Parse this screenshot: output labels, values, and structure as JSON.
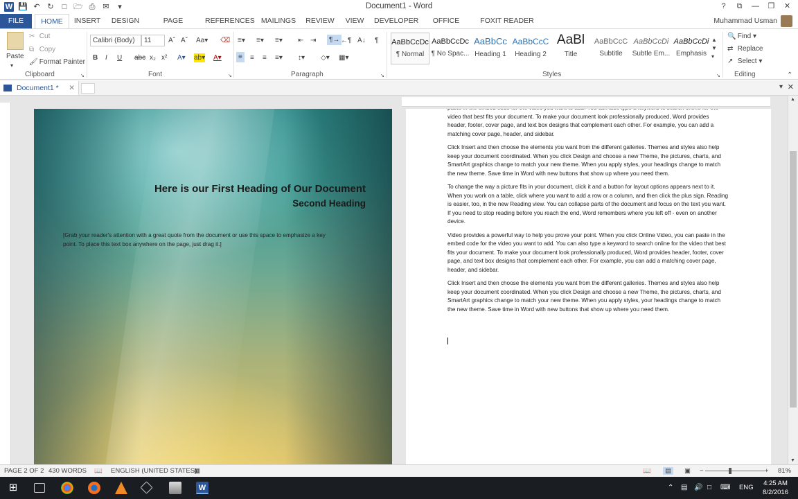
{
  "window": {
    "title": "Document1 - Word",
    "controls": [
      "?",
      "⧉",
      "—",
      "❐",
      "✕"
    ]
  },
  "tabs": {
    "file": "FILE",
    "items": [
      "HOME",
      "INSERT",
      "DESIGN",
      "PAGE LAYOUT",
      "REFERENCES",
      "MAILINGS",
      "REVIEW",
      "VIEW",
      "DEVELOPER",
      "OFFICE TAB",
      "FOXIT READER PDF"
    ],
    "active": "HOME"
  },
  "user": {
    "name": "Muhammad Usman"
  },
  "clipboard": {
    "paste": "Paste",
    "cut": "Cut",
    "copy": "Copy",
    "format_painter": "Format Painter",
    "label": "Clipboard"
  },
  "font": {
    "name": "Calibri (Body)",
    "size": "11",
    "label": "Font"
  },
  "paragraph": {
    "label": "Paragraph"
  },
  "styles": {
    "label": "Styles",
    "items": [
      {
        "sample": "AaBbCcDc",
        "name": "¶ Normal"
      },
      {
        "sample": "AaBbCcDc",
        "name": "¶ No Spac..."
      },
      {
        "sample": "AaBbCc",
        "name": "Heading 1"
      },
      {
        "sample": "AaBbCcC",
        "name": "Heading 2"
      },
      {
        "sample": "AaBl",
        "name": "Title"
      },
      {
        "sample": "AaBbCcC",
        "name": "Subtitle"
      },
      {
        "sample": "AaBbCcDi",
        "name": "Subtle Em..."
      },
      {
        "sample": "AaBbCcDi",
        "name": "Emphasis"
      }
    ]
  },
  "editing": {
    "find": "Find",
    "replace": "Replace",
    "select": "Select",
    "label": "Editing"
  },
  "doctab": {
    "name": "Document1 *",
    "close": "✕"
  },
  "cover": {
    "heading": "Here is our First Heading of Our Document",
    "subheading": "Second Heading",
    "quote": "[Grab your reader's attention with a great quote from the document or use this space to emphasize a key point. To place this text box anywhere on the page, just drag it.]"
  },
  "page2": {
    "paragraphs": [
      "paste in the embed code for the video you want to add. You can also type a keyword to search online for the video that best fits your document. To make your document look professionally produced, Word provides header, footer, cover page, and text box designs that complement each other. For example, you can add a matching cover page, header, and sidebar.",
      "Click Insert and then choose the elements you want from the different galleries. Themes and styles also help keep your document coordinated. When you click Design and choose a new Theme, the pictures, charts, and SmartArt graphics change to match your new theme. When you apply styles, your headings change to match the new theme. Save time in Word with new buttons that show up where you need them.",
      "To change the way a picture fits in your document, click it and a button for layout options appears next to it. When you work on a table, click where you want to add a row or a column, and then click the plus sign. Reading is easier, too, in the new Reading view. You can collapse parts of the document and focus on the text you want. If you need to stop reading before you reach the end, Word remembers where you left off - even on another device.",
      "Video provides a powerful way to help you prove your point. When you click Online Video, you can paste in the embed code for the video you want to add. You can also type a keyword to search online for the video that best fits your document. To make your document look professionally produced, Word provides header, footer, cover page, and text box designs that complement each other. For example, you can add a matching cover page, header, and sidebar.",
      "Click Insert and then choose the elements you want from the different galleries. Themes and styles also help keep your document coordinated. When you click Design and choose a new Theme, the pictures, charts, and SmartArt graphics change to match your new theme. When you apply styles, your headings change to match the new theme. Save time in Word with new buttons that show up where you need them."
    ]
  },
  "status": {
    "page": "PAGE 2 OF 2",
    "words": "430 WORDS",
    "language": "ENGLISH (UNITED STATES)",
    "zoom": "81%"
  },
  "taskbar": {
    "lang": "ENG",
    "time": "4:25 AM",
    "date": "8/2/2016"
  },
  "colors": {
    "accent": "#2b579a"
  }
}
